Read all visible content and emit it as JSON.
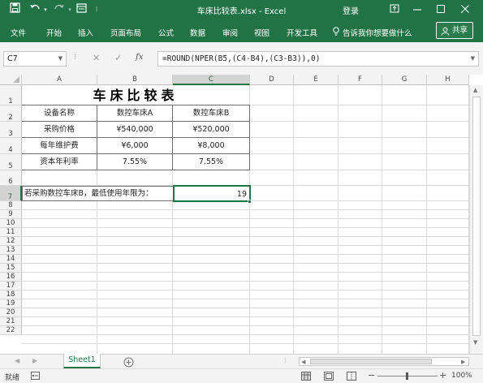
{
  "titlebar": {
    "title": "车床比较表.xlsx  -  Excel",
    "login": "登录",
    "save_icon": "save-icon",
    "undo_icon": "undo-icon",
    "redo_icon": "redo-icon",
    "form_icon": "form-icon",
    "customize_icon": "customize-qat-icon"
  },
  "ribbon": {
    "tabs": [
      "文件",
      "开始",
      "插入",
      "页面布局",
      "公式",
      "数据",
      "审阅",
      "视图",
      "开发工具"
    ],
    "tell_me": "告诉我你想要做什么",
    "share": "共享"
  },
  "formula_bar": {
    "name_box": "C7",
    "fx": "fx",
    "formula": "=ROUND(NPER(B5,(C4-B4),(C3-B3)),0)"
  },
  "columns": [
    "A",
    "B",
    "C",
    "D",
    "E",
    "F",
    "G",
    "H"
  ],
  "rows": [
    "1",
    "2",
    "3",
    "4",
    "5",
    "6",
    "7",
    "8",
    "9",
    "10",
    "11",
    "12",
    "13",
    "14",
    "15",
    "16",
    "17",
    "18",
    "19",
    "20",
    "21",
    "22"
  ],
  "sheet": {
    "title": "车床比较表",
    "header": [
      "设备名称",
      "数控车床A",
      "数控车床B"
    ],
    "row_purchase": [
      "采购价格",
      "¥540,000",
      "¥520,000"
    ],
    "row_maint": [
      "每年维护费",
      "¥6,000",
      "¥8,000"
    ],
    "row_rate": [
      "资本年利率",
      "7.55%",
      "7.55%"
    ],
    "question": "若采购数控车床B，最低使用年限为：",
    "answer": "19"
  },
  "sheet_tabs": {
    "active": "Sheet1"
  },
  "status": {
    "ready": "就绪",
    "zoom": "100%"
  }
}
